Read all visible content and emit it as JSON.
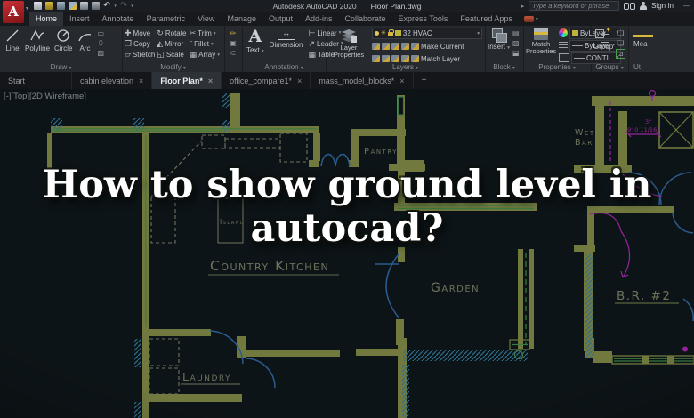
{
  "window": {
    "app_title": "Autodesk AutoCAD 2020",
    "doc_name": "Floor Plan.dwg",
    "search_placeholder": "Type a keyword or phrase",
    "sign_in_label": "Sign In"
  },
  "ui": {
    "caret": "▾",
    "close": "×",
    "plus": "+",
    "undo": "↶",
    "redo": "↷",
    "expander": "▸",
    "minimize": "—"
  },
  "ribbon_tabs": [
    {
      "label": "Home",
      "active": true
    },
    {
      "label": "Insert"
    },
    {
      "label": "Annotate"
    },
    {
      "label": "Parametric"
    },
    {
      "label": "View"
    },
    {
      "label": "Manage"
    },
    {
      "label": "Output"
    },
    {
      "label": "Add-ins"
    },
    {
      "label": "Collaborate"
    },
    {
      "label": "Express Tools"
    },
    {
      "label": "Featured Apps"
    }
  ],
  "panels": {
    "draw": {
      "label": "Draw",
      "tools": [
        "Line",
        "Polyline",
        "Circle",
        "Arc"
      ]
    },
    "modify": {
      "label": "Modify",
      "rows": [
        [
          "Move",
          "Rotate",
          "Trim"
        ],
        [
          "Copy",
          "Mirror",
          "Fillet"
        ],
        [
          "Stretch",
          "Scale",
          "Array"
        ]
      ]
    },
    "annotation": {
      "label": "Annotation",
      "text_tool": "Text",
      "dimension_tool": "Dimension",
      "stack": [
        "Linear",
        "Leader",
        "Table"
      ]
    },
    "layers": {
      "label": "Layers",
      "properties_tool": "Layer Properties",
      "current_layer": "32 HVAC",
      "make_current": "Make Current",
      "match_layer": "Match Layer"
    },
    "block": {
      "label": "Block",
      "insert_tool": "Insert"
    },
    "properties": {
      "label": "Properties",
      "match_tool": "Match Properties",
      "color": "ByLayer",
      "lineweight": "ByLayer",
      "linetype": "CONTI..."
    },
    "groups": {
      "label": "Groups",
      "group_tool": "Group"
    },
    "utilities": {
      "label": "Ut",
      "measure_tool": "Mea"
    }
  },
  "file_tabs": [
    {
      "label": "Start",
      "closable": false,
      "active": false
    },
    {
      "label": "cabin elevation",
      "closable": true,
      "active": false
    },
    {
      "label": "Floor Plan*",
      "closable": true,
      "active": true
    },
    {
      "label": "office_compare1*",
      "closable": true,
      "active": false
    },
    {
      "label": "mass_model_blocks*",
      "closable": true,
      "active": false
    }
  ],
  "viewport_label": "[-][Top][2D Wireframe]",
  "overlay": {
    "line1": "How to show ground level in",
    "line2": "autocad?"
  },
  "drawing": {
    "labels": {
      "pantry": "Pantry",
      "island": "Island",
      "kitchen": "Country Kitchen",
      "garden": "Garden",
      "wet": "Wet",
      "bar": "Bar",
      "bedroom2": "B.R. #2",
      "laundry": "Laundry"
    },
    "dimensions": {
      "d1": "3\"",
      "d2": "9'-0 11/16\""
    }
  },
  "colors": {
    "wall": "#71793f",
    "glass": "#3a7b41",
    "door": "#2a5d8f",
    "hatch": "#2f6e8e",
    "wiring": "#96249a",
    "label": "#6b745c",
    "canvas": "#0d1417",
    "accent": "#d8b93c"
  }
}
